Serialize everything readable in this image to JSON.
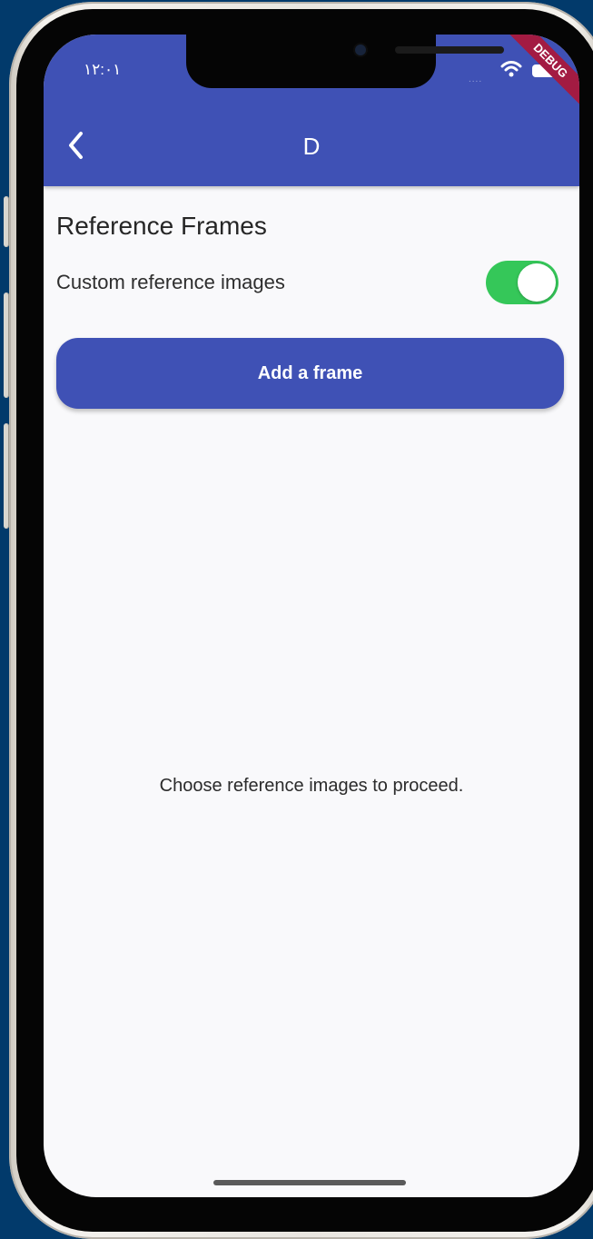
{
  "status_bar": {
    "time": "١٢:٠١",
    "signal_dots": "....",
    "wifi_icon": "wifi-icon",
    "battery_icon": "battery-icon",
    "debug_label": "DEBUG"
  },
  "app_bar": {
    "back_icon": "chevron-left-icon",
    "title": "D",
    "color": "#3f51b5"
  },
  "content": {
    "section_title": "Reference Frames",
    "custom_reference_label": "Custom reference images",
    "custom_reference_enabled": true,
    "add_frame_button": "Add a frame",
    "empty_message": "Choose reference images to proceed."
  },
  "colors": {
    "primary": "#3f51b5",
    "toggle_on": "#35c759",
    "background": "#f9f9fb",
    "outer_background": "#023a6b"
  }
}
